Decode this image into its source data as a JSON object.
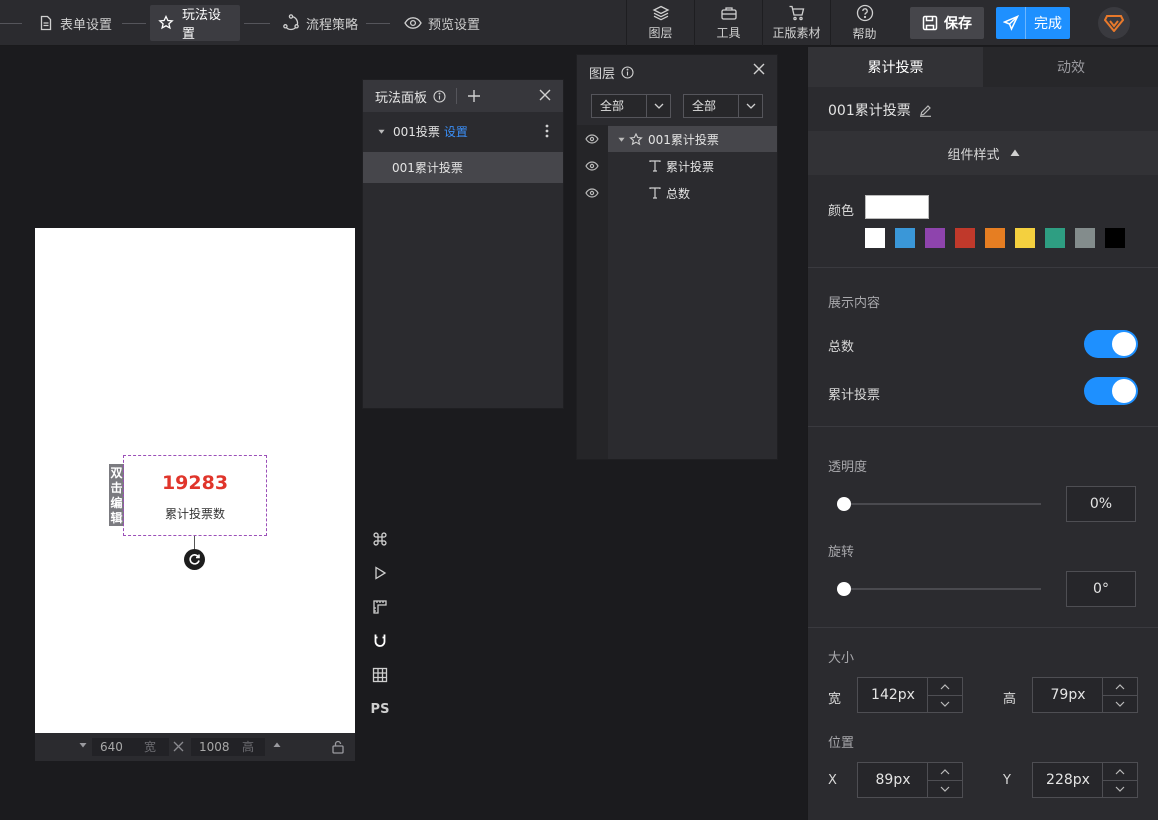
{
  "steps": [
    {
      "label": "表单设置",
      "icon": "document-icon"
    },
    {
      "label": "玩法设置",
      "icon": "star-settings-icon"
    },
    {
      "label": "流程策略",
      "icon": "flow-icon"
    },
    {
      "label": "预览设置",
      "icon": "eye-icon"
    }
  ],
  "tools": [
    {
      "label": "图层",
      "icon": "layers-icon"
    },
    {
      "label": "工具",
      "icon": "toolbox-icon"
    },
    {
      "label": "正版素材",
      "icon": "cart-icon"
    },
    {
      "label": "帮助",
      "icon": "help-icon"
    }
  ],
  "actions": {
    "save": "保存",
    "done": "完成"
  },
  "canvas": {
    "number": "19283",
    "label": "累计投票数",
    "dbl_click_tag": "双击编辑",
    "width": "640",
    "width_unit": "宽",
    "height": "1008",
    "height_unit": "高"
  },
  "side_tools": [
    {
      "icon": "command-icon"
    },
    {
      "icon": "play-icon"
    },
    {
      "icon": "ruler-icon"
    },
    {
      "icon": "magnet-icon"
    },
    {
      "icon": "grid-icon"
    },
    {
      "label": "PS",
      "icon": "ps-icon"
    }
  ],
  "play_panel": {
    "title": "玩法面板",
    "group_name": "001投票",
    "group_link": "设置",
    "item": "001累计投票"
  },
  "layer_panel": {
    "title": "图层",
    "filter1": "全部",
    "filter2": "全部",
    "rows": [
      {
        "label": "001累计投票",
        "icon": "component-icon"
      },
      {
        "label": "累计投票",
        "icon": "text-icon"
      },
      {
        "label": "总数",
        "icon": "text-icon"
      }
    ]
  },
  "right_panel": {
    "tabs": [
      "累计投票",
      "动效"
    ],
    "component_name": "001累计投票",
    "style_section": "组件样式",
    "color_label": "颜色",
    "current_color": "#ffffff",
    "palette": [
      "#ffffff",
      "#3a97d8",
      "#8e44ad",
      "#c0392b",
      "#e67e22",
      "#f4d03f",
      "#2e9e82",
      "#838c8c",
      "#000000"
    ],
    "display_section": "展示内容",
    "toggles": [
      {
        "label": "总数",
        "on": true
      },
      {
        "label": "累计投票",
        "on": true
      }
    ],
    "opacity_label": "透明度",
    "opacity_value": "0%",
    "opacity_level": 0,
    "rotation_label": "旋转",
    "rotation_value": "0°",
    "rotation_level": 0,
    "size_label": "大小",
    "width_label": "宽",
    "width_value": "142px",
    "height_label": "高",
    "height_value": "79px",
    "position_label": "位置",
    "x_label": "X",
    "x_value": "89px",
    "y_label": "Y",
    "y_value": "228px"
  },
  "colors": {
    "accent": "#1e90ff",
    "number_red": "#e0352b",
    "logo_orange": "#e8792b"
  }
}
